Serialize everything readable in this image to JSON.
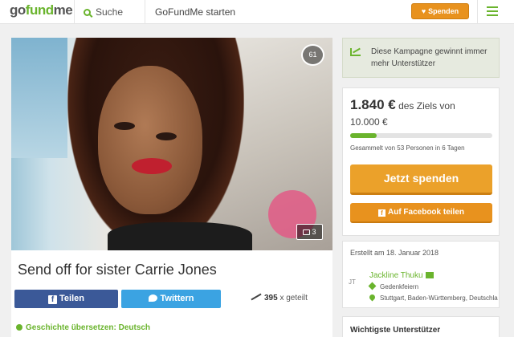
{
  "header": {
    "logo_go": "go",
    "logo_fund": "fund",
    "logo_me": "me",
    "search_label": "Suche",
    "start_label": "GoFundMe starten",
    "donate_label": "Spenden",
    "icons": [
      "search-icon",
      "heart-icon",
      "hamburger-menu-icon"
    ]
  },
  "campaign": {
    "title": "Send off for sister Carrie Jones",
    "hearts": "61",
    "photo_count": "3",
    "share_facebook": "Teilen",
    "share_twitter": "Twittern",
    "share_count": "395",
    "share_suffix": "x geteilt",
    "translate_label": "Geschichte übersetzen: Deutsch"
  },
  "sidebar": {
    "momentum_text": "Diese Kampagne gewinnt immer mehr Unterstützer",
    "raised_amount": "1.840 €",
    "raised_suffix": " des Ziels von",
    "goal": "10.000 €",
    "progress_fraction": 0.184,
    "collected_text": "Gesammelt von 53 Personen in 6 Tagen",
    "donate_button": "Jetzt spenden",
    "facebook_button": "Auf Facebook teilen",
    "created_text": "Erstellt am 18. Januar 2018",
    "organizer_initials": "JT",
    "organizer_name": "Jackline Thuku",
    "category": "Gedenkfeiern",
    "location": "Stuttgart, Baden-Württemberg, Deutschla",
    "supporters_heading": "Wichtigste Unterstützer"
  },
  "colors": {
    "brand_green": "#6ab42d",
    "donate_orange": "#eba12a",
    "facebook_blue": "#3b5998",
    "twitter_blue": "#3ba3e2"
  }
}
